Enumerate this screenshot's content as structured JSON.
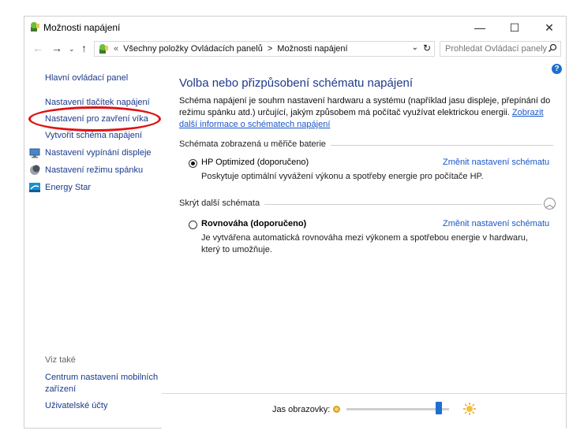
{
  "window": {
    "title": "Možnosti napájení",
    "minimize": "—",
    "maximize": "☐",
    "close": "✕"
  },
  "address": {
    "prefix": "«",
    "crumb1": "Všechny položky Ovládacích panelů",
    "separator": ">",
    "crumb2": "Možnosti napájení",
    "search_placeholder": "Prohledat Ovládací panely"
  },
  "sidebar": {
    "home": "Hlavní ovládací panel",
    "links": [
      "Nastavení tlačítek napájení",
      "Nastavení pro zavření víka",
      "Vytvořit schéma napájení"
    ],
    "items": [
      "Nastavení vypínání displeje",
      "Nastavení režimu spánku",
      "Energy Star"
    ],
    "see_also": "Viz také",
    "see_also_links": [
      "Centrum nastavení mobilních zařízení",
      "Uživatelské účty"
    ]
  },
  "main": {
    "heading": "Volba nebo přizpůsobení schématu napájení",
    "description": "Schéma napájení je souhrn nastavení hardwaru a systému (například jasu displeje, přepínání do režimu spánku atd.) určující, jakým způsobem má počítač využívat elektrickou energii.",
    "description_link": "Zobrazit další informace o schématech napájení",
    "section1": "Schémata zobrazená u měřiče baterie",
    "plan1": {
      "name": "HP Optimized (doporučeno)",
      "change": "Změnit nastavení schématu",
      "desc": "Poskytuje optimální vyvážení výkonu a spotřeby energie pro počítače HP.",
      "selected": true
    },
    "section2": "Skrýt další schémata",
    "plan2": {
      "name": "Rovnováha (doporučeno)",
      "change": "Změnit nastavení schématu",
      "desc": "Je vytvářena automatická rovnováha mezi výkonem a spotřebou energie v hardwaru, který to umožňuje.",
      "selected": false
    }
  },
  "footer": {
    "brightness_label": "Jas obrazovky:",
    "brightness_level": 0.9
  },
  "colors": {
    "link": "#1a56c9",
    "nav": "#1a3a8a",
    "heading": "#1e3a8a",
    "accent": "#1e6fd0",
    "annotation": "#e01212"
  }
}
